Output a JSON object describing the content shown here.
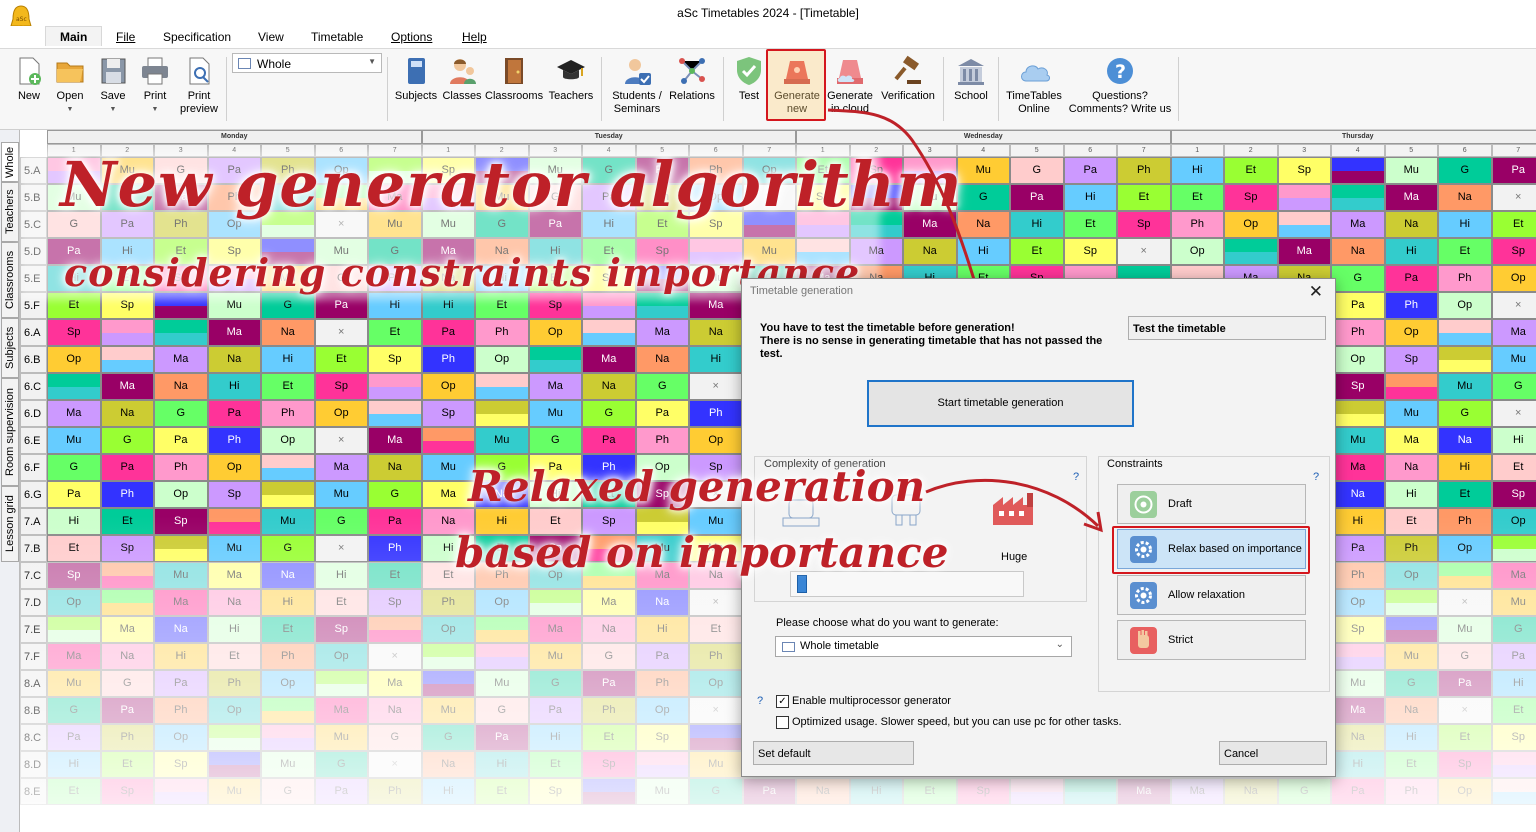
{
  "window": {
    "title": "aSc Timetables 2024  - [Timetable]"
  },
  "menu": {
    "items": [
      "Main",
      "File",
      "Specification",
      "View",
      "Timetable",
      "Options",
      "Help"
    ]
  },
  "ribbon": {
    "view_select": "Whole",
    "buttons": {
      "new": "New",
      "open": "Open",
      "save": "Save",
      "print": "Print",
      "print_preview_1": "Print",
      "print_preview_2": "preview",
      "subjects": "Subjects",
      "classes": "Classes",
      "classrooms": "Classrooms",
      "teachers": "Teachers",
      "students_1": "Students /",
      "students_2": "Seminars",
      "relations": "Relations",
      "test": "Test",
      "generate_1": "Generate",
      "generate_2": "new",
      "cloud_1": "Generate",
      "cloud_2": "in cloud",
      "verification": "Verification",
      "school": "School",
      "online_1": "TimeTables",
      "online_2": "Online",
      "questions_1": "Questions?",
      "questions_2": "Comments? Write us"
    },
    "colors": {
      "accent_highlight": "#d4161d",
      "icon_blue": "#3d6fb3"
    }
  },
  "side_tabs": [
    "Whole",
    "Teachers",
    "Classrooms",
    "Subjects",
    "Room supervision",
    "Lesson grid"
  ],
  "grid": {
    "days": [
      "Monday",
      "Tuesday",
      "Wednesday",
      "Thursday"
    ],
    "periods": [
      "1",
      "2",
      "3",
      "4",
      "5",
      "6",
      "7"
    ],
    "rows": [
      "5.A",
      "5.B",
      "5.C",
      "5.D",
      "5.E",
      "5.F",
      "6.A",
      "6.B",
      "6.C",
      "6.D",
      "6.E",
      "6.F",
      "6.G",
      "7.A",
      "7.B",
      "7.C",
      "7.D",
      "7.E",
      "7.F",
      "8.A",
      "8.B",
      "8.C",
      "8.D",
      "8.E"
    ]
  },
  "overlay": {
    "line1": "New generator algorithm",
    "line2": "considering constraints importance",
    "line3": "Relaxed generation",
    "line4": "based on importance"
  },
  "dialog": {
    "title": "Timetable generation",
    "message_1": "You have to test the timetable before generation!",
    "message_2": "There is no sense in generating timetable that has not passed the test.",
    "test_button": "Test the timetable",
    "start_button": "Start timetable generation",
    "complexity_label": "Complexity of generation",
    "help_mark": "?",
    "huge_label": "Huge",
    "constraints_label": "Constraints",
    "constraints": [
      "Draft",
      "Relax based on importance",
      "Allow relaxation",
      "Strict"
    ],
    "choose_label": "Please choose what do you want to generate:",
    "choose_value": "Whole timetable",
    "multiprocessor_label": "Enable multiprocessor generator",
    "multiprocessor_checked": true,
    "optimized_label": "Optimized usage. Slower speed, but you can use pc for other tasks.",
    "optimized_checked": false,
    "set_default": "Set default",
    "cancel": "Cancel",
    "close_glyph": "✕"
  }
}
